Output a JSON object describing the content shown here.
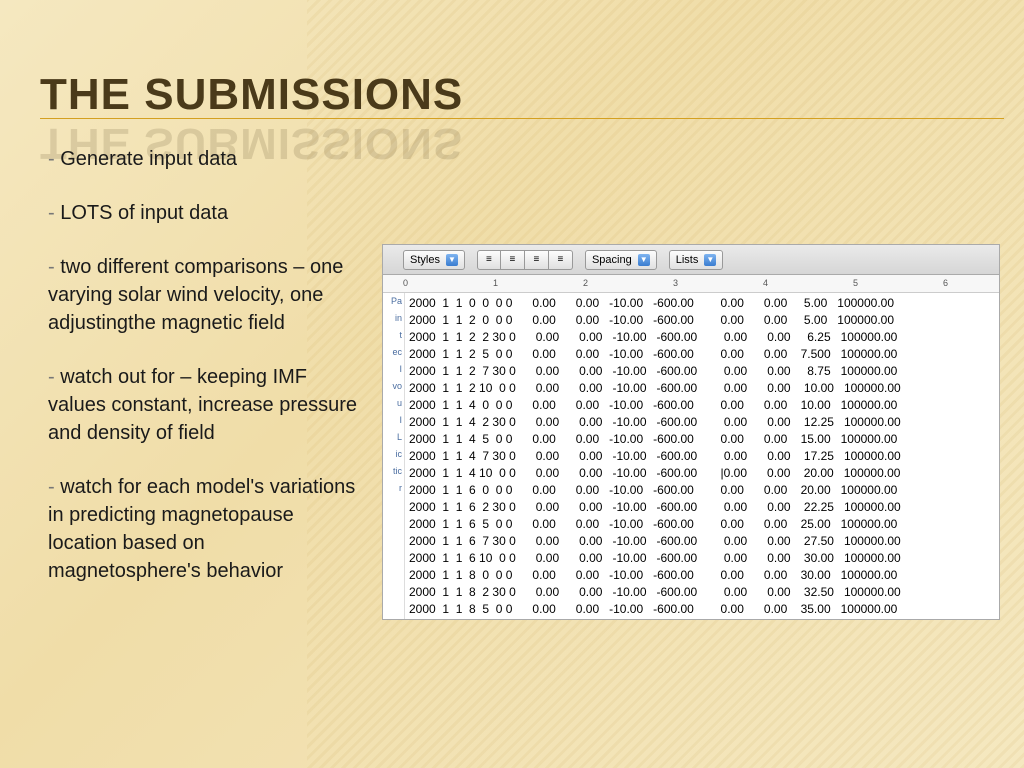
{
  "title": "THE SUBMISSIONS",
  "bullets": [
    "Generate input data",
    "LOTS of input data",
    "two different comparisons – one varying solar wind velocity, one adjustingthe magnetic field",
    "watch out for – keeping IMF values constant, increase pressure and density of field",
    "watch for each model's variations in predicting magnetopause location based on magnetosphere's behavior"
  ],
  "toolbar": {
    "styles": "Styles",
    "spacing": "Spacing",
    "lists": "Lists"
  },
  "ruler_marks": [
    "0",
    "1",
    "2",
    "3",
    "4",
    "5",
    "6"
  ],
  "left_strip": [
    "Pa",
    "in",
    " ",
    "t",
    "ec",
    " ",
    "I",
    "vo",
    "u",
    " ",
    "I",
    "L",
    "ic",
    "tic",
    "r"
  ],
  "data_rows": [
    "2000  1  1  0  0  0 0      0.00      0.00   -10.00   -600.00        0.00      0.00     5.00   100000.00",
    "2000  1  1  2  0  0 0      0.00      0.00   -10.00   -600.00        0.00      0.00     5.00   100000.00",
    "2000  1  1  2  2 30 0      0.00      0.00   -10.00   -600.00        0.00      0.00     6.25   100000.00",
    "2000  1  1  2  5  0 0      0.00      0.00   -10.00   -600.00        0.00      0.00    7.500   100000.00",
    "2000  1  1  2  7 30 0      0.00      0.00   -10.00   -600.00        0.00      0.00     8.75   100000.00",
    "2000  1  1  2 10  0 0      0.00      0.00   -10.00   -600.00        0.00      0.00    10.00   100000.00",
    "2000  1  1  4  0  0 0      0.00      0.00   -10.00   -600.00        0.00      0.00    10.00   100000.00",
    "2000  1  1  4  2 30 0      0.00      0.00   -10.00   -600.00        0.00      0.00    12.25   100000.00",
    "2000  1  1  4  5  0 0      0.00      0.00   -10.00   -600.00        0.00      0.00    15.00   100000.00",
    "2000  1  1  4  7 30 0      0.00      0.00   -10.00   -600.00        0.00      0.00    17.25   100000.00",
    "2000  1  1  4 10  0 0      0.00      0.00   -10.00   -600.00       |0.00      0.00    20.00   100000.00",
    "2000  1  1  6  0  0 0      0.00      0.00   -10.00   -600.00        0.00      0.00    20.00   100000.00",
    "2000  1  1  6  2 30 0      0.00      0.00   -10.00   -600.00        0.00      0.00    22.25   100000.00",
    "2000  1  1  6  5  0 0      0.00      0.00   -10.00   -600.00        0.00      0.00    25.00   100000.00",
    "2000  1  1  6  7 30 0      0.00      0.00   -10.00   -600.00        0.00      0.00    27.50   100000.00",
    "2000  1  1  6 10  0 0      0.00      0.00   -10.00   -600.00        0.00      0.00    30.00   100000.00",
    "2000  1  1  8  0  0 0      0.00      0.00   -10.00   -600.00        0.00      0.00    30.00   100000.00",
    "2000  1  1  8  2 30 0      0.00      0.00   -10.00   -600.00        0.00      0.00    32.50   100000.00",
    "2000  1  1  8  5  0 0      0.00      0.00   -10.00   -600.00        0.00      0.00    35.00   100000.00"
  ]
}
